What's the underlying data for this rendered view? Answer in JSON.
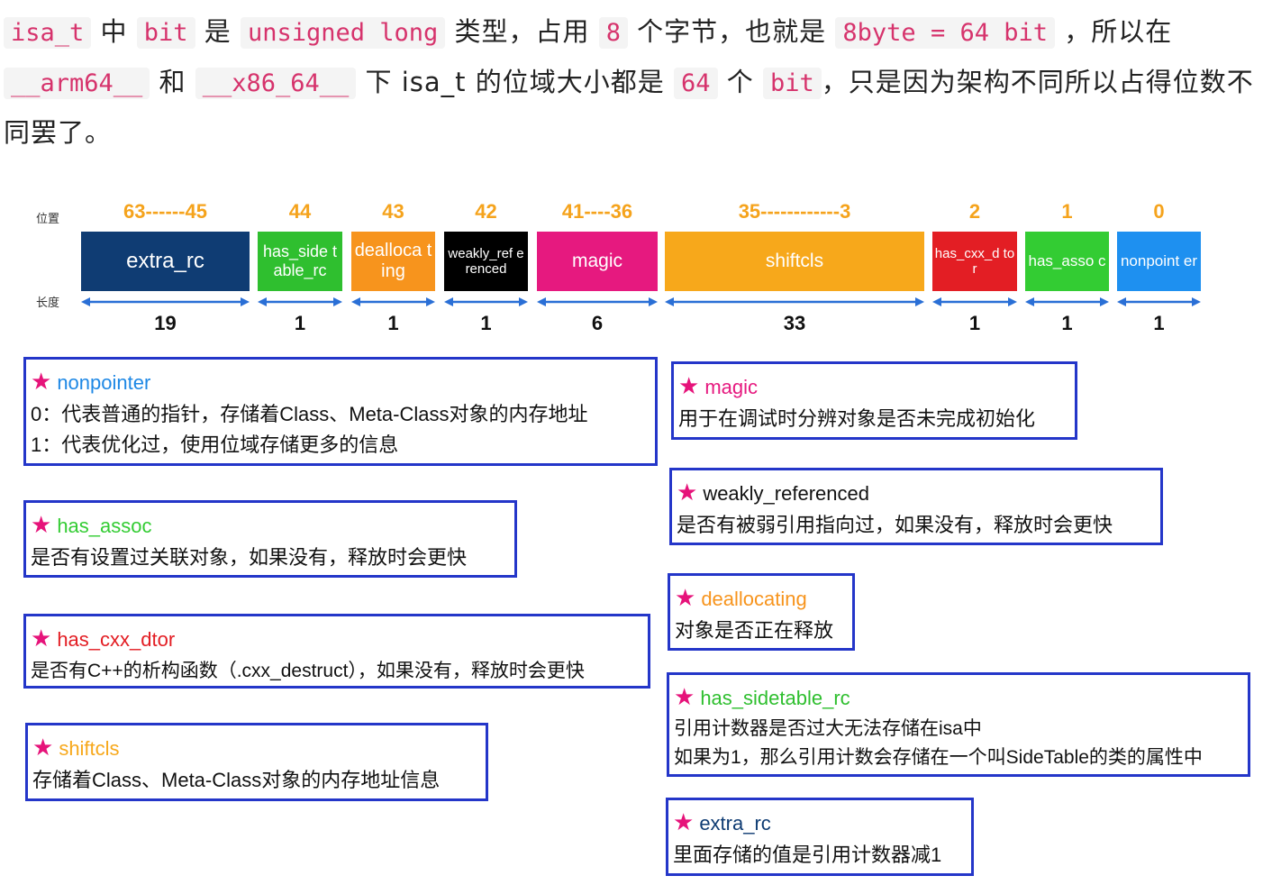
{
  "paragraph": {
    "segments": [
      {
        "t": "isa_t",
        "code": true
      },
      {
        "t": " 中 "
      },
      {
        "t": "bit",
        "code": true
      },
      {
        "t": " 是 "
      },
      {
        "t": "unsigned long",
        "code": true
      },
      {
        "t": " 类型，占用 "
      },
      {
        "t": "8",
        "code": true
      },
      {
        "t": " 个字节，也就是 "
      },
      {
        "t": "8byte = 64 bit",
        "code": true
      },
      {
        "t": " ，所以在 "
      },
      {
        "t": "__arm64__",
        "code": true
      },
      {
        "t": " 和 "
      },
      {
        "t": "__x86_64__",
        "code": true
      },
      {
        "t": " 下 isa_t 的位域大小都是 "
      },
      {
        "t": "64",
        "code": true
      },
      {
        "t": " 个 "
      },
      {
        "t": "bit",
        "code": true
      },
      {
        "t": "，只是因为架构不同所以占得位数不同罢了。"
      }
    ]
  },
  "diagram": {
    "position_label": "位置",
    "length_label": "长度",
    "colors": {
      "position_text": "#f5a31c",
      "arrow": "#2a6fd6",
      "box_border": "#2436c9",
      "star": "#e6137a"
    },
    "fields": [
      {
        "name": "extra_rc",
        "position": "63------45",
        "length": "19",
        "color": "#0f3c73"
      },
      {
        "name": "has_side table_rc",
        "position": "44",
        "length": "1",
        "color": "#2fbf2f"
      },
      {
        "name": "dealloca ting",
        "position": "43",
        "length": "1",
        "color": "#f7941d"
      },
      {
        "name": "weakly_ref erenced",
        "position": "42",
        "length": "1",
        "color": "#000000"
      },
      {
        "name": "magic",
        "position": "41----36",
        "length": "6",
        "color": "#e6197f"
      },
      {
        "name": "shiftcls",
        "position": "35------------3",
        "length": "33",
        "color": "#f7a81b"
      },
      {
        "name": "has_cxx_d tor",
        "position": "2",
        "length": "1",
        "color": "#e31e24"
      },
      {
        "name": "has_asso c",
        "position": "1",
        "length": "1",
        "color": "#33cc33"
      },
      {
        "name": "nonpoint er",
        "position": "0",
        "length": "1",
        "color": "#1e90f0"
      }
    ]
  },
  "boxes": [
    {
      "id": "nonpointer",
      "title": "nonpointer",
      "title_color": "#1e88e5",
      "lines": [
        "0：代表普通的指针，存储着Class、Meta-Class对象的内存地址",
        "1：代表优化过，使用位域存储更多的信息"
      ]
    },
    {
      "id": "has-assoc",
      "title": "has_assoc",
      "title_color": "#33cc33",
      "lines": [
        "是否有设置过关联对象，如果没有，释放时会更快"
      ]
    },
    {
      "id": "has-cxx-dtor",
      "title": "has_cxx_dtor",
      "title_color": "#e31e24",
      "lines": [
        "是否有C++的析构函数（.cxx_destruct），如果没有，释放时会更快"
      ]
    },
    {
      "id": "shiftcls",
      "title": "shiftcls",
      "title_color": "#f7a81b",
      "lines": [
        "存储着Class、Meta-Class对象的内存地址信息"
      ]
    },
    {
      "id": "magic",
      "title": "magic",
      "title_color": "#e6197f",
      "lines": [
        "用于在调试时分辨对象是否未完成初始化"
      ]
    },
    {
      "id": "weakly-referenced",
      "title": "weakly_referenced",
      "title_color": "#111111",
      "lines": [
        "是否有被弱引用指向过，如果没有，释放时会更快"
      ]
    },
    {
      "id": "deallocating",
      "title": "deallocating",
      "title_color": "#f7941d",
      "lines": [
        "对象是否正在释放"
      ]
    },
    {
      "id": "has-sidetable-rc",
      "title": "has_sidetable_rc",
      "title_color": "#2fbf2f",
      "lines": [
        "引用计数器是否过大无法存储在isa中",
        "如果为1，那么引用计数会存储在一个叫SideTable的类的属性中"
      ]
    },
    {
      "id": "extra-rc",
      "title": "extra_rc",
      "title_color": "#0f3c73",
      "lines": [
        "里面存储的值是引用计数器减1"
      ]
    }
  ]
}
